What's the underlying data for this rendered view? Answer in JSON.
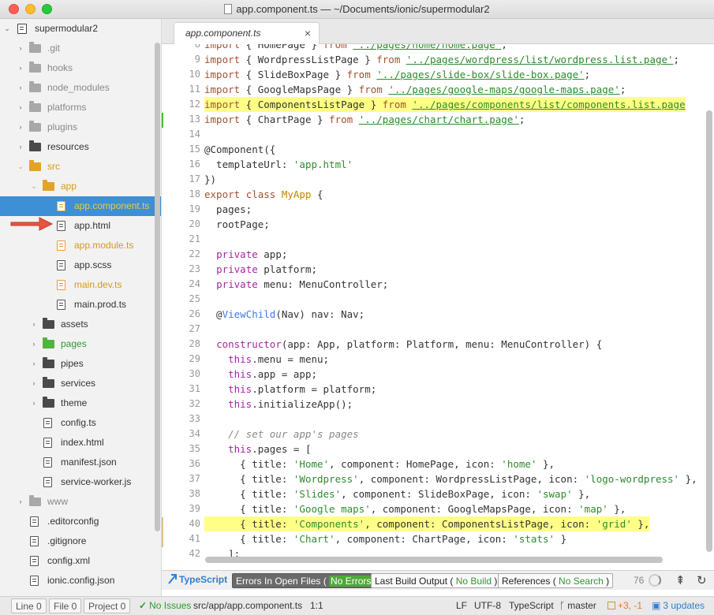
{
  "window": {
    "title": "app.component.ts — ~/Documents/ionic/supermodular2"
  },
  "tabs": [
    {
      "label": "app.component.ts",
      "close": "×"
    }
  ],
  "tree": {
    "root": "supermodular2",
    "items": [
      {
        "label": ".git",
        "kind": "folder",
        "color": "grey",
        "arrow": "›",
        "state": "closed"
      },
      {
        "label": "hooks",
        "kind": "folder",
        "color": "grey",
        "arrow": "›",
        "state": "closed"
      },
      {
        "label": "node_modules",
        "kind": "folder",
        "color": "grey",
        "arrow": "›",
        "state": "closed"
      },
      {
        "label": "platforms",
        "kind": "folder",
        "color": "grey",
        "arrow": "›",
        "state": "closed"
      },
      {
        "label": "plugins",
        "kind": "folder",
        "color": "grey",
        "arrow": "›",
        "state": "closed"
      },
      {
        "label": "resources",
        "kind": "folder",
        "color": "dark",
        "arrow": "›",
        "state": "closed"
      },
      {
        "label": "src",
        "kind": "folder",
        "color": "orange",
        "arrow": "⌄",
        "state": "open"
      },
      {
        "label": "app",
        "kind": "folder",
        "color": "orange",
        "arrow": "⌄",
        "state": "open"
      },
      {
        "label": "app.component.ts",
        "kind": "file",
        "color": "orange",
        "selected": true
      },
      {
        "label": "app.html",
        "kind": "file",
        "color": "dark"
      },
      {
        "label": "app.module.ts",
        "kind": "file",
        "color": "orange"
      },
      {
        "label": "app.scss",
        "kind": "file",
        "color": "dark"
      },
      {
        "label": "main.dev.ts",
        "kind": "file",
        "color": "orange"
      },
      {
        "label": "main.prod.ts",
        "kind": "file",
        "color": "dark"
      },
      {
        "label": "assets",
        "kind": "folder",
        "color": "dark",
        "arrow": "›",
        "state": "closed"
      },
      {
        "label": "pages",
        "kind": "folder",
        "color": "green",
        "arrow": "›",
        "state": "closed"
      },
      {
        "label": "pipes",
        "kind": "folder",
        "color": "dark",
        "arrow": "›",
        "state": "closed"
      },
      {
        "label": "services",
        "kind": "folder",
        "color": "dark",
        "arrow": "›",
        "state": "closed"
      },
      {
        "label": "theme",
        "kind": "folder",
        "color": "dark",
        "arrow": "›",
        "state": "closed"
      },
      {
        "label": "config.ts",
        "kind": "file",
        "color": "dark"
      },
      {
        "label": "index.html",
        "kind": "file",
        "color": "dark"
      },
      {
        "label": "manifest.json",
        "kind": "file",
        "color": "dark"
      },
      {
        "label": "service-worker.js",
        "kind": "file",
        "color": "dark"
      },
      {
        "label": "www",
        "kind": "folder",
        "color": "grey",
        "arrow": "›",
        "state": "closed"
      },
      {
        "label": ".editorconfig",
        "kind": "file",
        "color": "dark"
      },
      {
        "label": ".gitignore",
        "kind": "file",
        "color": "dark"
      },
      {
        "label": "config.xml",
        "kind": "file",
        "color": "dark"
      },
      {
        "label": "ionic.config.json",
        "kind": "file",
        "color": "dark"
      }
    ]
  },
  "editor": {
    "lines": [
      {
        "n": "8",
        "text": "import { HomePage } from '../pages/home/home.page';"
      },
      {
        "n": "9",
        "text": "import { WordpressListPage } from '../pages/wordpress/list/wordpress.list.page';"
      },
      {
        "n": "10",
        "text": "import { SlideBoxPage } from '../pages/slide-box/slide-box.page';"
      },
      {
        "n": "11",
        "text": "import { GoogleMapsPage } from '../pages/google-maps/google-maps.page';"
      },
      {
        "n": "12",
        "text": "import { ComponentsListPage } from '../pages/components/list/components.list.page",
        "hl": true
      },
      {
        "n": "13",
        "text": "import { ChartPage } from '../pages/chart/chart.page';"
      },
      {
        "n": "14",
        "text": ""
      },
      {
        "n": "15",
        "text": "@Component({"
      },
      {
        "n": "16",
        "text": "  templateUrl: 'app.html'"
      },
      {
        "n": "17",
        "text": "})"
      },
      {
        "n": "18",
        "text": "export class MyApp {"
      },
      {
        "n": "19",
        "text": "  pages;"
      },
      {
        "n": "20",
        "text": "  rootPage;"
      },
      {
        "n": "21",
        "text": ""
      },
      {
        "n": "22",
        "text": "  private app;"
      },
      {
        "n": "23",
        "text": "  private platform;"
      },
      {
        "n": "24",
        "text": "  private menu: MenuController;"
      },
      {
        "n": "25",
        "text": ""
      },
      {
        "n": "26",
        "text": "  @ViewChild(Nav) nav: Nav;"
      },
      {
        "n": "27",
        "text": ""
      },
      {
        "n": "28",
        "text": "  constructor(app: App, platform: Platform, menu: MenuController) {"
      },
      {
        "n": "29",
        "text": "    this.menu = menu;"
      },
      {
        "n": "30",
        "text": "    this.app = app;"
      },
      {
        "n": "31",
        "text": "    this.platform = platform;"
      },
      {
        "n": "32",
        "text": "    this.initializeApp();"
      },
      {
        "n": "33",
        "text": ""
      },
      {
        "n": "34",
        "text": "    // set our app's pages"
      },
      {
        "n": "35",
        "text": "    this.pages = ["
      },
      {
        "n": "36",
        "text": "      { title: 'Home', component: HomePage, icon: 'home' },"
      },
      {
        "n": "37",
        "text": "      { title: 'Wordpress', component: WordpressListPage, icon: 'logo-wordpress' },"
      },
      {
        "n": "38",
        "text": "      { title: 'Slides', component: SlideBoxPage, icon: 'swap' },"
      },
      {
        "n": "39",
        "text": "      { title: 'Google maps', component: GoogleMapsPage, icon: 'map' },"
      },
      {
        "n": "40",
        "text": "      { title: 'Components', component: ComponentsListPage, icon: 'grid' },",
        "hl": true
      },
      {
        "n": "41",
        "text": "      { title: 'Chart', component: ChartPage, icon: 'stats' }"
      },
      {
        "n": "42",
        "text": "    ];"
      }
    ]
  },
  "panel": {
    "brand": "TypeScript",
    "errors_label": "Errors In Open Files",
    "errors_status": "No Errors",
    "build_label": "Last Build Output",
    "build_status": "No Build",
    "refs_label": "References",
    "refs_status": "No Search",
    "count": "76"
  },
  "status": {
    "line_btn": "Line 0",
    "file_btn": "File 0",
    "project_btn": "Project 0",
    "issues": "No Issues",
    "path": "src/app/app.component.ts",
    "cursor": "1:1",
    "eol": "LF",
    "encoding": "UTF-8",
    "grammar": "TypeScript",
    "branch": "master",
    "diff_add": "+3,",
    "diff_del": "-1",
    "updates": "3 updates"
  },
  "colors": {
    "selection": "#3d8fd6",
    "highlight": "#ffff88",
    "accent": "#2f7fd1"
  }
}
